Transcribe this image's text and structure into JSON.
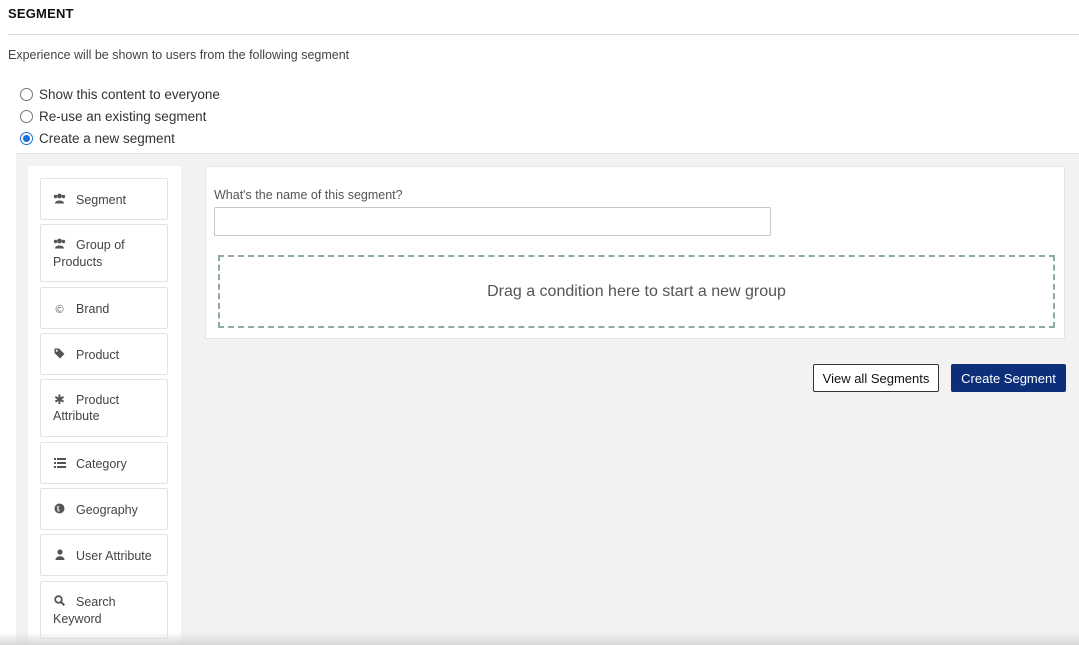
{
  "header": {
    "title": "SEGMENT",
    "description": "Experience will be shown to users from the following segment"
  },
  "segment_options": [
    {
      "label": "Show this content to everyone",
      "selected": false
    },
    {
      "label": "Re-use an existing segment",
      "selected": false
    },
    {
      "label": "Create a new segment",
      "selected": true
    }
  ],
  "conditions": [
    {
      "label": "Segment",
      "icon": "users-icon"
    },
    {
      "label": "Group of Products",
      "icon": "users-icon"
    },
    {
      "label": "Brand",
      "icon": "copyright-icon"
    },
    {
      "label": "Product",
      "icon": "tag-icon"
    },
    {
      "label": "Product Attribute",
      "icon": "asterisk-icon"
    },
    {
      "label": "Category",
      "icon": "list-icon"
    },
    {
      "label": "Geography",
      "icon": "globe-icon"
    },
    {
      "label": "User Attribute",
      "icon": "user-icon"
    },
    {
      "label": "Search Keyword",
      "icon": "search-icon"
    }
  ],
  "form": {
    "name_label": "What's the name of this segment?",
    "name_value": "",
    "dropzone_text": "Drag a condition here to start a new group"
  },
  "actions": {
    "view_all_label": "View all Segments",
    "create_label": "Create Segment"
  },
  "colors": {
    "primary": "#0d2f7a",
    "radio_selected": "#1a6fd9",
    "panel_bg": "#f2f2f2"
  }
}
